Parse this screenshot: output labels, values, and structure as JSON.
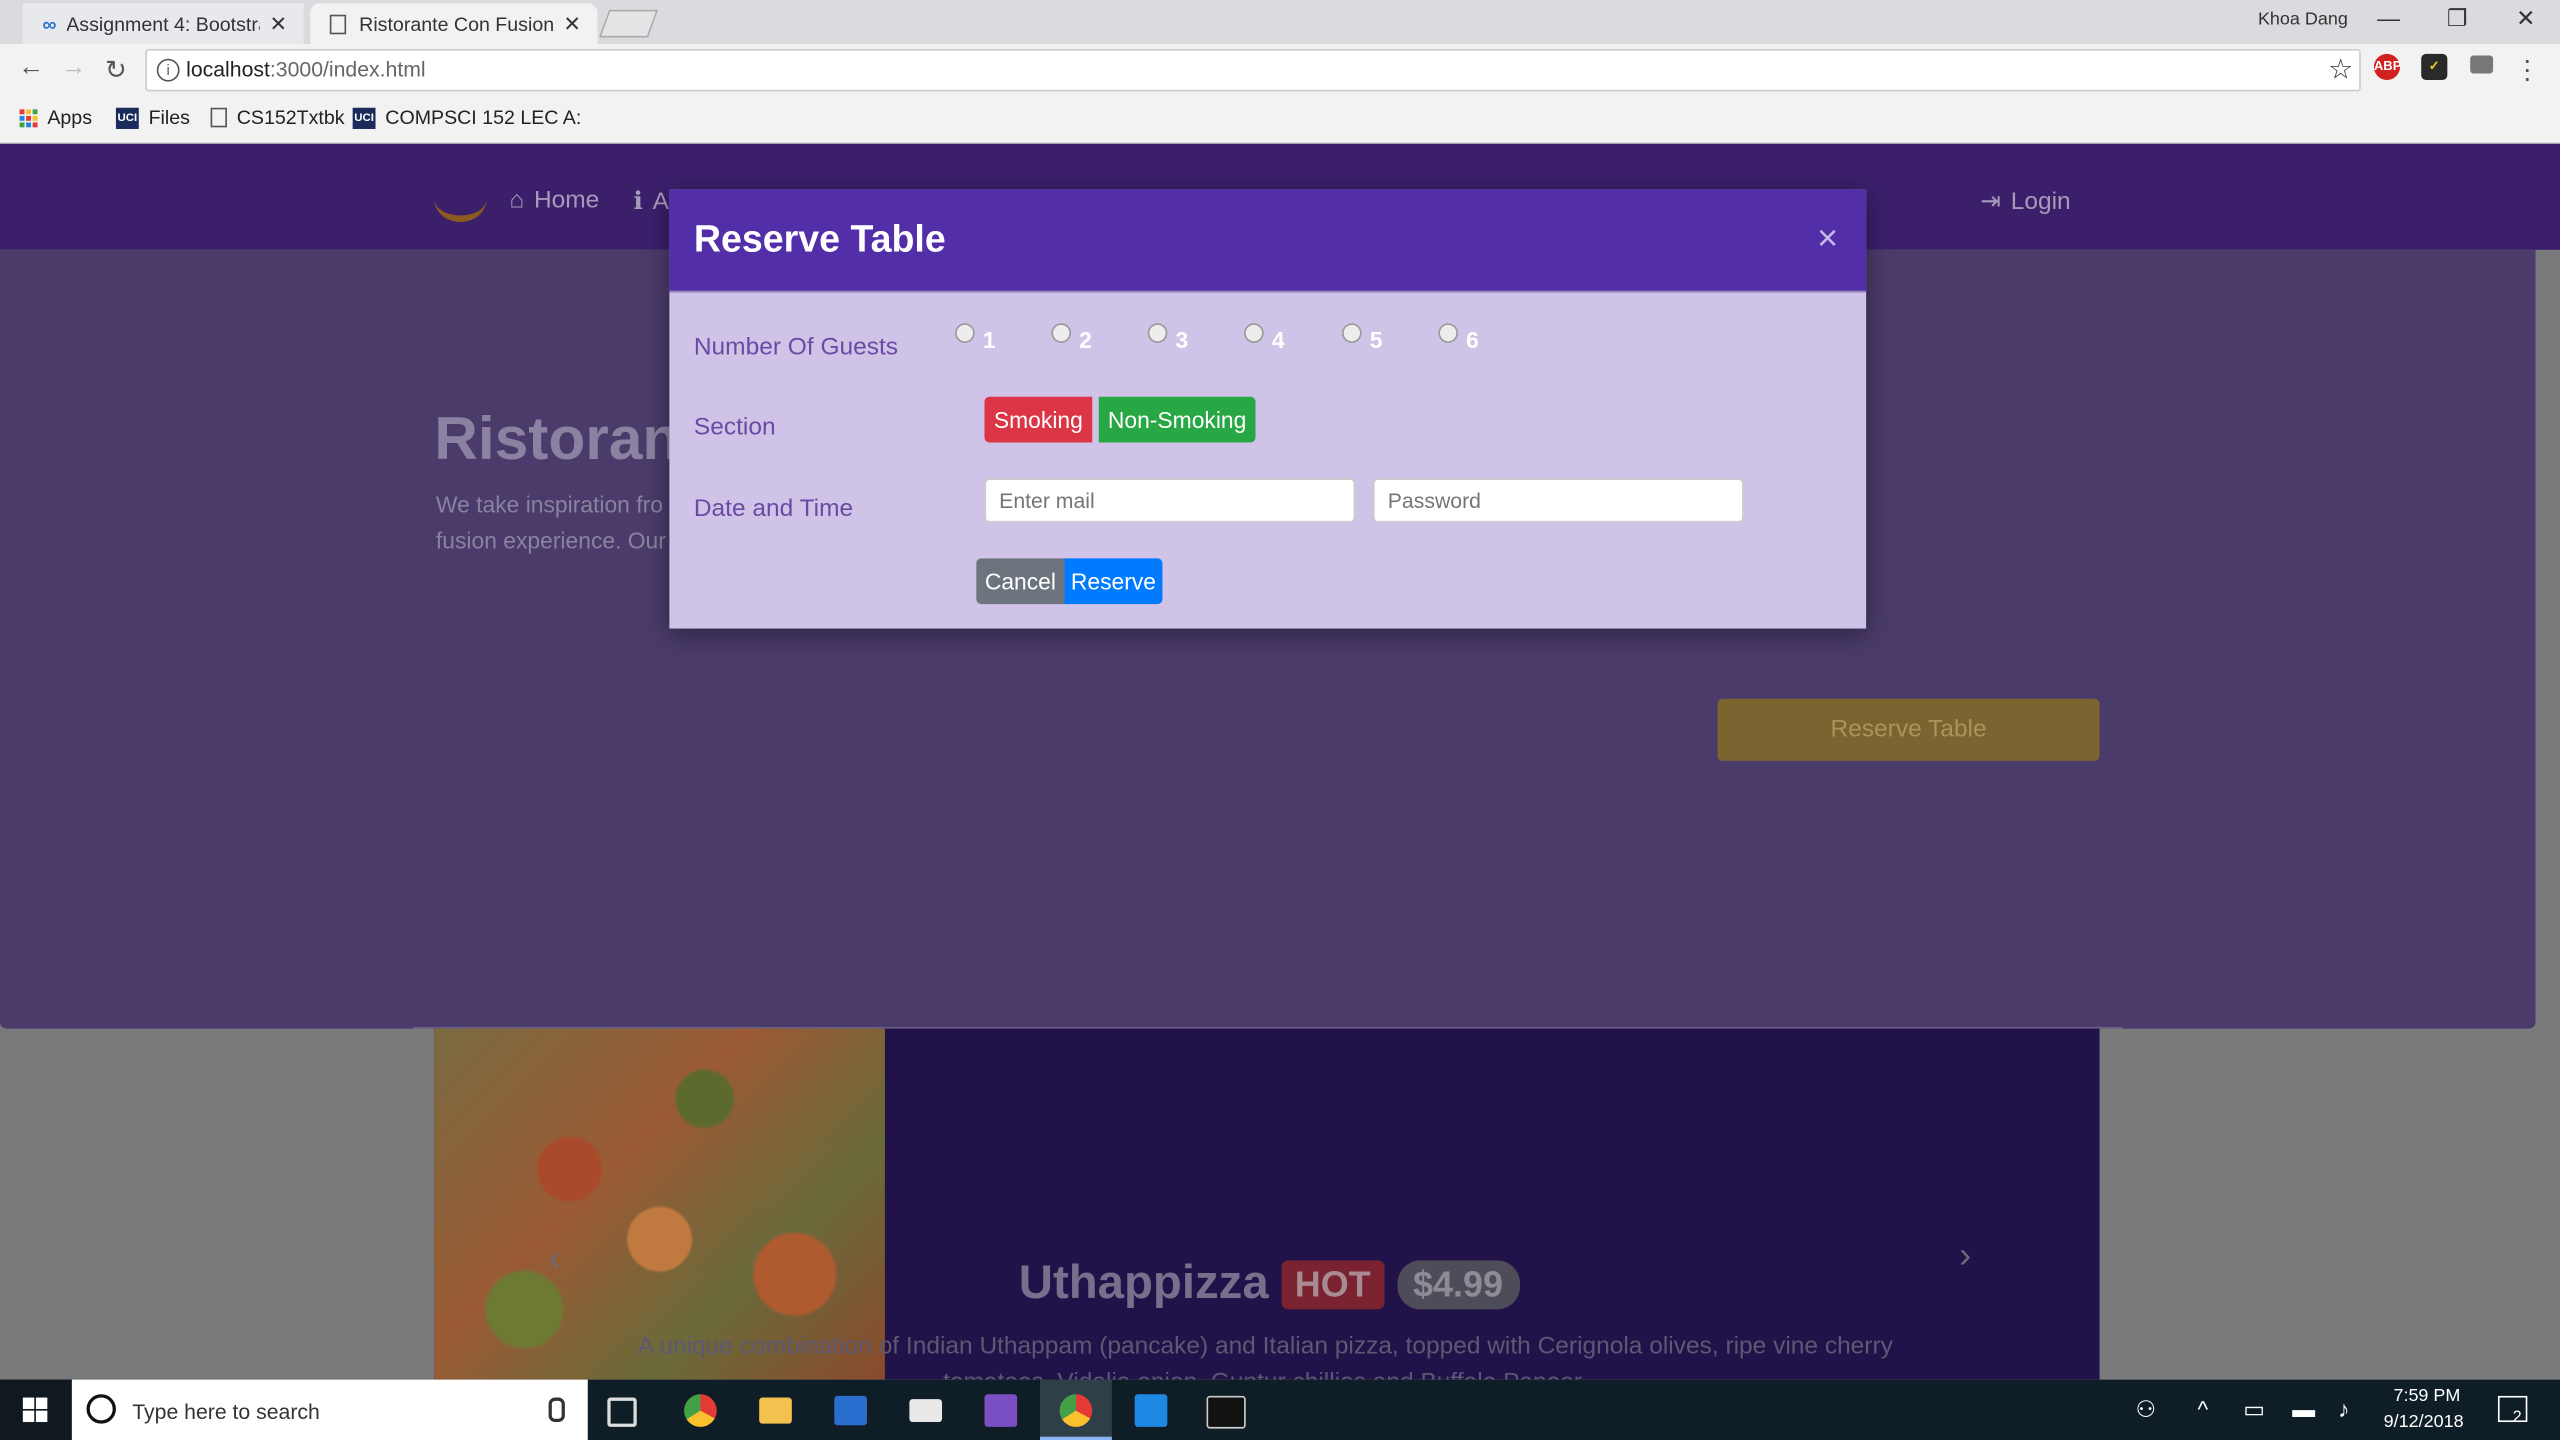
{
  "browser": {
    "tabs": [
      {
        "title": "Assignment 4: Bootstrap",
        "close": "✕"
      },
      {
        "title": "Ristorante Con Fusion",
        "close": "✕"
      }
    ],
    "user": "Khoa Dang",
    "window_controls": {
      "minimize": "—",
      "restore": "❐",
      "close": "✕"
    },
    "url_host": "localhost",
    "url_rest": ":3000/index.html",
    "bookmarks": [
      {
        "label": "Apps"
      },
      {
        "label": "Files",
        "icon_text": "UCI"
      },
      {
        "label": "CS152Txtbk"
      },
      {
        "label": "COMPSCI 152 LEC A:",
        "icon_text": "UCI"
      }
    ],
    "extensions": [
      "ABP",
      "✓"
    ]
  },
  "navbar": {
    "home": "Home",
    "about_partial": "A",
    "login": "Login"
  },
  "hero": {
    "title": "Ristorant",
    "desc_line1": "We take inspiration fro",
    "desc_line2": "fusion experience. Our",
    "button": "Reserve Table"
  },
  "carousel": {
    "dish": "Uthappizza",
    "badge": "HOT",
    "price": "$4.99",
    "description": "A unique combination of Indian Uthappam (pancake) and Italian pizza, topped with Cerignola olives, ripe vine cherry tomatoes, Vidalia onion, Guntur chillies and Buffalo Paneer."
  },
  "modal": {
    "title": "Reserve Table",
    "close": "×",
    "guests_label": "Number Of Guests",
    "guest_options": [
      "1",
      "2",
      "3",
      "4",
      "5",
      "6"
    ],
    "section_label": "Section",
    "smoking": "Smoking",
    "non_smoking": "Non-Smoking",
    "datetime_label": "Date and Time",
    "date_placeholder": "Enter mail",
    "time_placeholder": "Password",
    "cancel": "Cancel",
    "reserve": "Reserve"
  },
  "taskbar": {
    "search_placeholder": "Type here to search",
    "time": "7:59 PM",
    "date": "9/12/2018",
    "notifications": "2"
  },
  "colors": {
    "modal_header": "#522ea8",
    "modal_body": "#d0c3e8",
    "smoking": "#dc3545",
    "non_smoking": "#28a745",
    "cancel": "#6c757d",
    "reserve": "#007bff"
  }
}
